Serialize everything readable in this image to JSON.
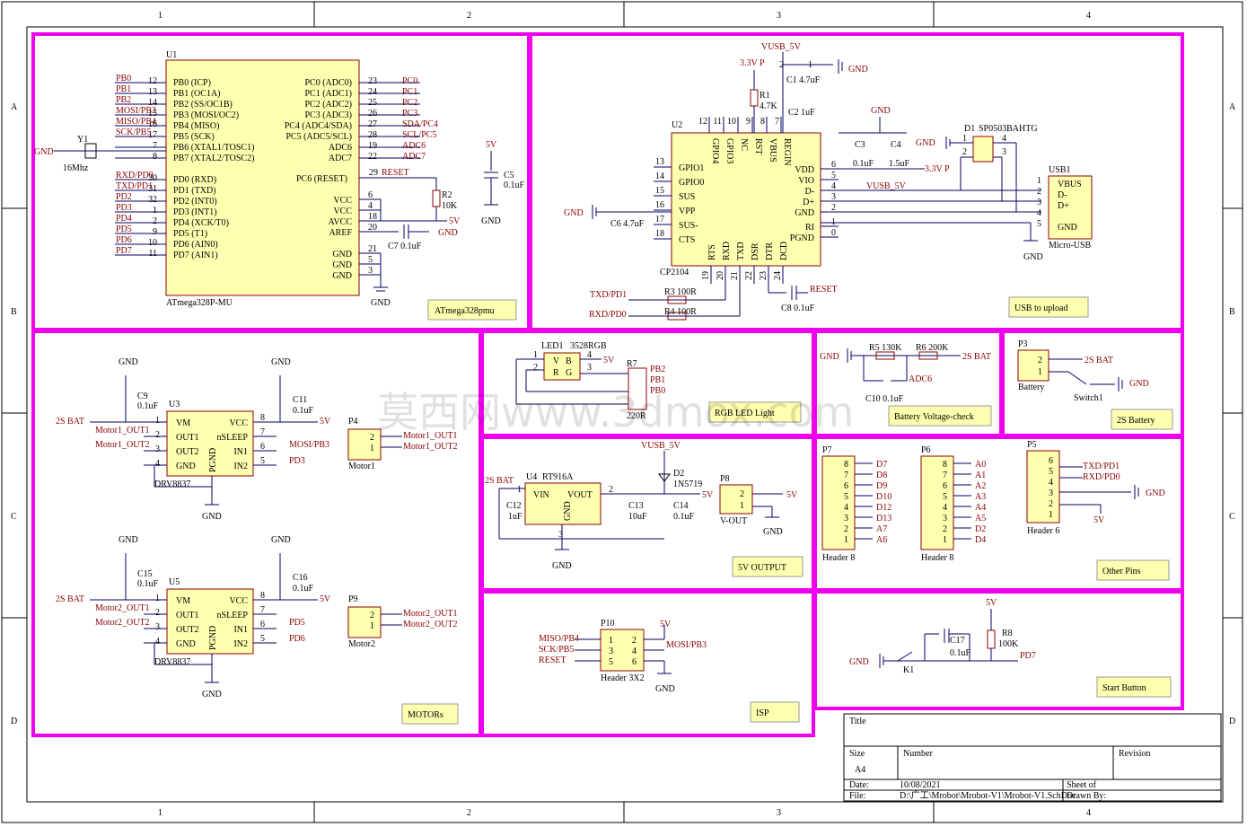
{
  "grid": {
    "columns": [
      "1",
      "2",
      "3",
      "4"
    ],
    "rows": [
      "A",
      "B",
      "C",
      "D"
    ]
  },
  "mcu": {
    "ref": "U1",
    "part": "ATmega328P-MU",
    "left_pins": [
      {
        "net": "PB0",
        "num": "12",
        "name": "PB0 (ICP)"
      },
      {
        "net": "PB1",
        "num": "13",
        "name": "PB1 (OC1A)"
      },
      {
        "net": "PB2",
        "num": "14",
        "name": "PB2 (SS/OC1B)"
      },
      {
        "net": "MOSI/PB3",
        "num": "15",
        "name": "PB3 (MOSI/OC2)"
      },
      {
        "net": "MISO/PB4",
        "num": "16",
        "name": "PB4 (MISO)"
      },
      {
        "net": "SCK/PB5",
        "num": "17",
        "name": "PB5 (SCK)"
      },
      {
        "net": "",
        "num": "7",
        "name": "PB6 (XTAL1/TOSC1)"
      },
      {
        "net": "",
        "num": "8",
        "name": "PB7 (XTAL2/TOSC2)"
      },
      {
        "net": "RXD/PD0",
        "num": "30",
        "name": "PD0 (RXD)"
      },
      {
        "net": "TXD/PD1",
        "num": "31",
        "name": "PD1 (TXD)"
      },
      {
        "net": "PD2",
        "num": "32",
        "name": "PD2 (INT0)"
      },
      {
        "net": "PD3",
        "num": "1",
        "name": "PD3 (INT1)"
      },
      {
        "net": "PD4",
        "num": "2",
        "name": "PD4 (XCK/T0)"
      },
      {
        "net": "PD5",
        "num": "9",
        "name": "PD5 (T1)"
      },
      {
        "net": "PD6",
        "num": "10",
        "name": "PD6 (AIN0)"
      },
      {
        "net": "PD7",
        "num": "11",
        "name": "PD7 (AIN1)"
      }
    ],
    "right_pins": [
      {
        "name": "PC0 (ADC0)",
        "num": "23",
        "net": "PC0"
      },
      {
        "name": "PC1 (ADC1)",
        "num": "24",
        "net": "PC1"
      },
      {
        "name": "PC2 (ADC2)",
        "num": "25",
        "net": "PC2"
      },
      {
        "name": "PC3 (ADC3)",
        "num": "26",
        "net": "PC3"
      },
      {
        "name": "PC4 (ADC4/SDA)",
        "num": "27",
        "net": "SDA/PC4"
      },
      {
        "name": "PC5 (ADC5/SCL)",
        "num": "28",
        "net": "SCL/PC5"
      },
      {
        "name": "ADC6",
        "num": "19",
        "net": "ADC6"
      },
      {
        "name": "ADC7",
        "num": "22",
        "net": "ADC7"
      }
    ],
    "reset_pin": {
      "name": "PC6 (RESET)",
      "num": "29",
      "net": "RESET"
    },
    "power_pins": [
      {
        "name": "VCC",
        "num": "6"
      },
      {
        "name": "VCC",
        "num": "4"
      },
      {
        "name": "AVCC",
        "num": "18"
      },
      {
        "name": "AREF",
        "num": "20"
      }
    ],
    "gnd_pins": [
      {
        "name": "GND",
        "num": "21"
      },
      {
        "name": "GND",
        "num": "5"
      },
      {
        "name": "GND",
        "num": "3"
      }
    ],
    "crystal": {
      "ref": "Y1",
      "value": "16Mhz",
      "gnd": "GND"
    },
    "r2": {
      "ref": "R2",
      "value": "10K"
    },
    "c7": {
      "label": "C7  0.1uF"
    },
    "vcc": "5V",
    "gnd": "GND",
    "c5": {
      "ref": "C5",
      "value": "0.1uF",
      "vcc": "5V",
      "gnd": "GND"
    },
    "note": "ATmega328pmu"
  },
  "usb": {
    "ref": "U2",
    "part": "CP2104",
    "top_pins": [
      {
        "num": "12",
        "name": "GPIO4"
      },
      {
        "num": "11",
        "name": "GPIO3"
      },
      {
        "num": "10",
        "name": "NC"
      },
      {
        "num": "9",
        "name": "RST"
      },
      {
        "num": "8",
        "name": "VBUS"
      },
      {
        "num": "7",
        "name": "REGIN"
      }
    ],
    "left_pins": [
      {
        "num": "13",
        "name": "GPIO1"
      },
      {
        "num": "14",
        "name": "GPIO0"
      },
      {
        "num": "15",
        "name": "SUS"
      },
      {
        "num": "16",
        "name": "VPP"
      },
      {
        "num": "17",
        "name": "SUS-"
      },
      {
        "num": "18",
        "name": "CTS"
      }
    ],
    "right_pins": [
      {
        "num": "6",
        "name": "VDD"
      },
      {
        "num": "5",
        "name": "VIO"
      },
      {
        "num": "4",
        "name": "D-"
      },
      {
        "num": "3",
        "name": "D+"
      },
      {
        "num": "2",
        "name": "GND"
      },
      {
        "num": "1",
        "name": "RI"
      },
      {
        "num": "0",
        "name": "PGND"
      }
    ],
    "bottom_pins": [
      {
        "num": "19",
        "name": "RTS"
      },
      {
        "num": "20",
        "name": "RXD"
      },
      {
        "num": "21",
        "name": "TXD"
      },
      {
        "num": "22",
        "name": "DSR"
      },
      {
        "num": "23",
        "name": "DTR"
      },
      {
        "num": "24",
        "name": "DCD"
      }
    ],
    "vusb": "VUSB_5V",
    "v33": "3.3V P",
    "gnd": "GND",
    "c1": "C1 4.7uF",
    "c1_pin": "1",
    "c1_pin2": "2",
    "c2": "C2 1uF",
    "r1": {
      "ref": "R1",
      "value": "4.7K"
    },
    "c3": {
      "ref": "C3",
      "value": "0.1uF"
    },
    "c4": {
      "ref": "C4",
      "value": "1.5uF"
    },
    "c6": "C6 4.7uF",
    "c8": "C8  0.1uF",
    "r3": "R3  100R",
    "r4": "R4  100R",
    "txd": "TXD/PD1",
    "rxd": "RXD/PD0",
    "reset": "RESET",
    "d1": {
      "ref": "D1",
      "part": "SP0503BAHTG",
      "pins": [
        "1",
        "2",
        "3",
        "4"
      ]
    },
    "usb1": {
      "ref": "USB1",
      "part": "Micro-USB",
      "pins": [
        {
          "num": "1",
          "name": "VBUS"
        },
        {
          "num": "2",
          "name": "D-"
        },
        {
          "num": "3",
          "name": "D+"
        },
        {
          "num": "4",
          "name": ""
        },
        {
          "num": "5",
          "name": "GND"
        }
      ]
    },
    "v33_right": "3.3V P",
    "vusb_right": "VUSB_5V",
    "note": "USB to upload"
  },
  "motors": {
    "drivers": [
      {
        "ref": "U3",
        "part": "DRV8837",
        "cap": {
          "ref": "C9",
          "value": "0.1uF"
        },
        "cap2": {
          "ref": "C11",
          "value": "0.1uF"
        },
        "vm_net": "2S BAT",
        "vcc_net": "5V",
        "out1": "Motor1_OUT1",
        "out2": "Motor1_OUT2",
        "in1": "MOSI/PB3",
        "in2": "PD3",
        "conn": {
          "ref": "P4",
          "name": "Motor1",
          "out1": "Motor1_OUT1",
          "out2": "Motor1_OUT2"
        }
      },
      {
        "ref": "U5",
        "part": "DRV8837",
        "cap": {
          "ref": "C15",
          "value": "0.1uF"
        },
        "cap2": {
          "ref": "C16",
          "value": "0.1uF"
        },
        "vm_net": "2S BAT",
        "vcc_net": "5V",
        "out1": "Motor2_OUT1",
        "out2": "Motor2_OUT2",
        "in1": "PD5",
        "in2": "PD6",
        "conn": {
          "ref": "P9",
          "name": "Motor2",
          "out1": "Motor2_OUT1",
          "out2": "Motor2_OUT2"
        }
      }
    ],
    "pin_names_left": [
      "VM",
      "OUT1",
      "OUT2",
      "GND"
    ],
    "pin_nums_left": [
      "1",
      "2",
      "3",
      "4"
    ],
    "pin_names_right": [
      "VCC",
      "nSLEEP",
      "IN1",
      "IN2"
    ],
    "pin_nums_right": [
      "8",
      "7",
      "6",
      "5"
    ],
    "pgnd": "PGND",
    "conn_pins": [
      "2",
      "1"
    ],
    "gnd": "GND",
    "note": "MOTORs"
  },
  "led": {
    "ref": "LED1",
    "part": "3528RGB",
    "pins": [
      "1",
      "2",
      "3",
      "4"
    ],
    "cells": [
      "V",
      "B",
      "R",
      "G"
    ],
    "vcc": "5V",
    "r7": {
      "ref": "R7",
      "value": "220R"
    },
    "nets": [
      "PB2",
      "PB1",
      "PB0"
    ],
    "note": "RGB LED Light"
  },
  "battery_check": {
    "r5": "R5  130K",
    "r6": "R6  200K",
    "net": "2S BAT",
    "adc": "ADC6",
    "c10": "C10  0.1uF",
    "gnd": "GND",
    "note": "Battery Voltage-check"
  },
  "battery": {
    "ref": "P3",
    "name": "Battery",
    "pins": [
      "2",
      "1"
    ],
    "net": "2S BAT",
    "switch": "Switch1",
    "gnd": "GND",
    "note": "2S Battery"
  },
  "reg": {
    "ref": "U4",
    "part": "RT916A",
    "vin": "VIN",
    "vout": "VOUT",
    "gnd": "GND",
    "in_net": "2S BAT",
    "pin1": "1",
    "pin2": "2",
    "pin3": "3",
    "c12": {
      "ref": "C12",
      "value": "1uF"
    },
    "c13": {
      "ref": "C13",
      "value": "10uF"
    },
    "c14": {
      "ref": "C14",
      "value": "0.1uF"
    },
    "d2": {
      "ref": "D2",
      "part": "1N5719"
    },
    "vusb": "VUSB_5V",
    "out_net": "5V",
    "p8": {
      "ref": "P8",
      "name": "V-OUT",
      "pins": [
        "2",
        "1"
      ],
      "net": "5V",
      "gnd": "GND"
    },
    "gnd_label": "GND",
    "note": "5V OUTPUT"
  },
  "headers": {
    "p7": {
      "ref": "P7",
      "name": "Header 8",
      "pins": [
        "8",
        "7",
        "6",
        "5",
        "4",
        "3",
        "2",
        "1"
      ],
      "nets": [
        "D7",
        "D8",
        "D9",
        "D10",
        "D12",
        "D13",
        "A7",
        "A6"
      ]
    },
    "p6": {
      "ref": "P6",
      "name": "Header 8",
      "pins": [
        "8",
        "7",
        "6",
        "5",
        "4",
        "3",
        "2",
        "1"
      ],
      "nets": [
        "A0",
        "A1",
        "A2",
        "A3",
        "A4",
        "A5",
        "D2",
        "D4"
      ]
    },
    "p5": {
      "ref": "P5",
      "name": "Header 6",
      "pins": [
        "6",
        "5",
        "4",
        "3",
        "2",
        "1"
      ],
      "nets": [
        "TXD/PD1",
        "RXD/PD0",
        "GND",
        "5V"
      ]
    },
    "note": "Other Pins"
  },
  "isp": {
    "ref": "P10",
    "name": "Header 3X2",
    "left_pins": [
      "1",
      "3",
      "5"
    ],
    "right_pins": [
      "2",
      "4",
      "6"
    ],
    "left_nets": [
      "MISO/PB4",
      "SCK/PB5",
      "RESET"
    ],
    "right_nets": [
      "5V",
      "MOSI/PB3",
      "GND"
    ],
    "note": "ISP"
  },
  "start": {
    "vcc": "5V",
    "r8": {
      "ref": "R8",
      "value": "100K"
    },
    "c17": {
      "ref": "C17",
      "value": "0.1uF"
    },
    "k1": "K1",
    "net": "PD7",
    "gnd": "GND",
    "note": "Start Button"
  },
  "title_block": {
    "title_label": "Title",
    "size_label": "Size",
    "size_value": "A4",
    "number_label": "Number",
    "revision_label": "Revision",
    "date_label": "Date:",
    "date_value": "10/08/2021",
    "sheet_label": "Sheet   of",
    "file_label": "File:",
    "file_value": "D:\\广工\\Mrobot\\Mrobot-V1\\Mrobot-V1.SchDoc",
    "drawn_label": "Drawn By:"
  },
  "watermark": "莫西网www.3dmox.com",
  "colors": {
    "box": "#ee00ee",
    "chip": "#ffffb0",
    "net": "#8b0000",
    "wire": "#000066"
  }
}
